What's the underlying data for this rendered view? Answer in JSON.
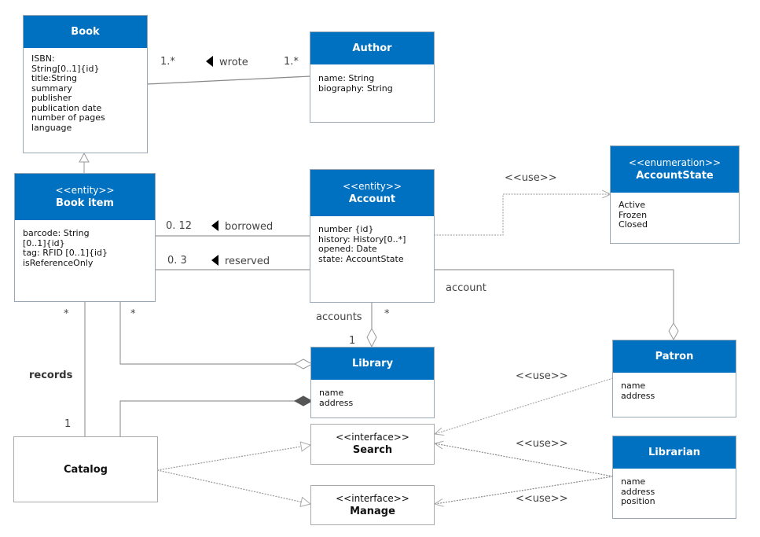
{
  "diagram": {
    "type": "UML class diagram",
    "colors": {
      "header": "#0070c0",
      "header_text": "#ffffff",
      "line": "#999999"
    },
    "classes": {
      "book": {
        "stereotype": "",
        "name": "Book",
        "attributes": [
          "ISBN:",
          "String[0..1]{id}",
          "title:String",
          "summary",
          "publisher",
          "publication date",
          "number of pages",
          "language"
        ]
      },
      "author": {
        "stereotype": "",
        "name": "Author",
        "attributes": [
          "name: String",
          "biography: String"
        ]
      },
      "book_item": {
        "stereotype": "<<entity>>",
        "name": "Book item",
        "attributes": [
          "barcode: String",
          "[0..1]{id}",
          "tag: RFID [0..1]{id}",
          "isReferenceOnly"
        ]
      },
      "account": {
        "stereotype": "<<entity>>",
        "name": "Account",
        "attributes": [
          "number {id}",
          "history: History[0..*]",
          "opened: Date",
          "state: AccountState"
        ]
      },
      "account_state": {
        "stereotype": "<<enumeration>>",
        "name": "AccountState",
        "attributes": [
          "Active",
          "Frozen",
          "Closed"
        ]
      },
      "library": {
        "stereotype": "",
        "name": "Library",
        "attributes": [
          "name",
          "address"
        ]
      },
      "patron": {
        "stereotype": "",
        "name": "Patron",
        "attributes": [
          "name",
          "address"
        ]
      },
      "librarian": {
        "stereotype": "",
        "name": "Librarian",
        "attributes": [
          "name",
          "address",
          "position"
        ]
      },
      "catalog": {
        "name": "Catalog"
      },
      "search": {
        "stereotype": "<<interface>>",
        "name": "Search"
      },
      "manage": {
        "stereotype": "<<interface>>",
        "name": "Manage"
      }
    },
    "labels": {
      "wrote": "wrote",
      "wrote_mult_book": "1.*",
      "wrote_mult_author": "1.*",
      "borrowed": "borrowed",
      "borrowed_mult": "0. 12",
      "reserved": "reserved",
      "reserved_mult": "0. 3",
      "use_account_state": "<<use>>",
      "account_role": "account",
      "accounts_role": "accounts",
      "accounts_mult_many": "*",
      "accounts_mult_one": "1",
      "bookitem_catalog_mult": "*",
      "bookitem_library_mult": "*",
      "records": "records",
      "records_mult_one": "1",
      "use_patron_search": "<<use>>",
      "use_librarian_search": "<<use>>",
      "use_librarian_manage": "<<use>>"
    }
  }
}
